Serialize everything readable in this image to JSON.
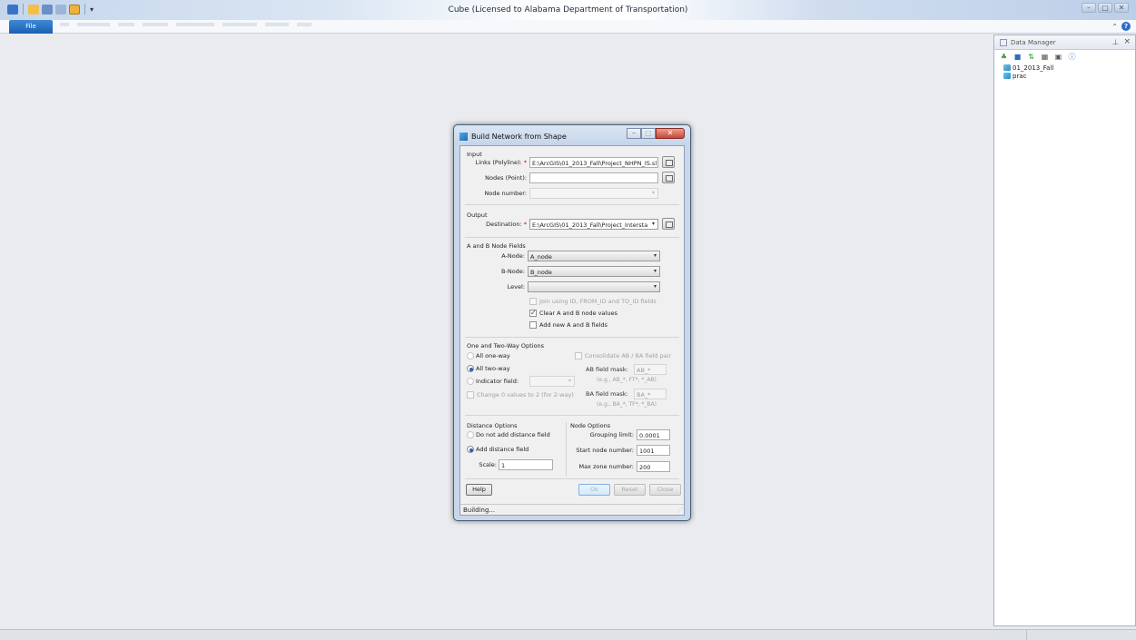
{
  "app": {
    "title": "Cube (Licensed to Alabama Department of Transportation)",
    "file_tab": "File"
  },
  "data_manager": {
    "title": "Data Manager",
    "items": [
      "01_2013_Fall",
      "prac"
    ]
  },
  "dialog": {
    "title": "Build Network from Shape",
    "input": {
      "group": "Input",
      "links_label": "Links (Polyline):",
      "links_value": "E:\\ArcGIS\\01_2013_Fall\\Project_NHPN_IS.sl",
      "nodes_label": "Nodes (Point):",
      "nodes_value": "",
      "node_number_label": "Node number:"
    },
    "output": {
      "group": "Output",
      "destination_label": "Destination:",
      "destination_value": "E:\\ArcGIS\\01_2013_Fall\\Project_Intersta"
    },
    "ab": {
      "group": "A and B Node Fields",
      "a_label": "A-Node:",
      "a_value": "A_node",
      "b_label": "B-Node:",
      "b_value": "B_node",
      "level_label": "Level:",
      "join_label": "Join using ID, FROM_ID and TO_ID fields",
      "clear_label": "Clear A and B node values",
      "add_label": "Add new A and B fields"
    },
    "oneway": {
      "group": "One and Two-Way Options",
      "all_one": "All one-way",
      "all_two": "All two-way",
      "indicator": "Indicator field:",
      "change": "Change 0 values to 2 (for 2-way)",
      "consolidate": "Consolidate AB / BA field pair",
      "ab_mask_label": "AB field mask:",
      "ab_mask_value": "AB_*",
      "ab_hint": "(e.g., AB_*, FT*, *_AB)",
      "ba_mask_label": "BA field mask:",
      "ba_mask_value": "BA_*",
      "ba_hint": "(e.g., BA_*, TF*, *_BA)"
    },
    "distance": {
      "group": "Distance Options",
      "no_add": "Do not add distance field",
      "add": "Add distance field",
      "scale_label": "Scale:",
      "scale_value": "1"
    },
    "node_opts": {
      "group": "Node Options",
      "grouping_label": "Grouping limit:",
      "grouping_value": "0.0001",
      "start_label": "Start node number:",
      "start_value": "1001",
      "max_label": "Max zone number:",
      "max_value": "200"
    },
    "buttons": {
      "help": "Help",
      "ok": "Ok",
      "reset": "Reset",
      "close": "Close"
    },
    "status": "Building..."
  }
}
